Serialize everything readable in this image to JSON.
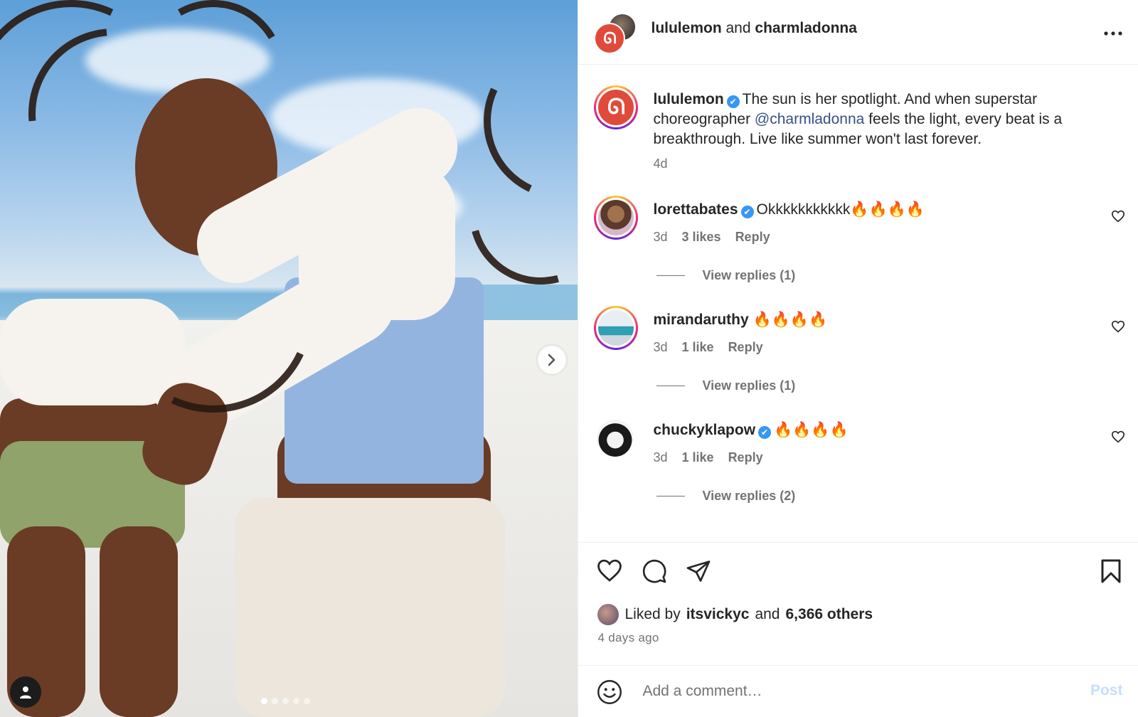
{
  "header": {
    "user1": "lululemon",
    "and": "and",
    "user2": "charmladonna"
  },
  "caption": {
    "username": "lululemon",
    "text_before": "The sun is her spotlight. And when superstar choreographer ",
    "mention": "@charmladonna",
    "text_after": " feels the light, every beat is a breakthrough. Live like summer won't last forever.",
    "time": "4d"
  },
  "comments": [
    {
      "username": "lorettabates",
      "verified": true,
      "text": "Okkkkkkkkkkk🔥🔥🔥🔥",
      "time": "3d",
      "likes": "3 likes",
      "reply": "Reply",
      "view_replies": "View replies (1)"
    },
    {
      "username": "mirandaruthy",
      "verified": false,
      "text": "🔥🔥🔥🔥",
      "time": "3d",
      "likes": "1 like",
      "reply": "Reply",
      "view_replies": "View replies (1)"
    },
    {
      "username": "chuckyklapow",
      "verified": true,
      "text": "🔥🔥🔥🔥",
      "time": "3d",
      "likes": "1 like",
      "reply": "Reply",
      "view_replies": "View replies (2)"
    }
  ],
  "likes": {
    "prefix": "Liked by",
    "user": "itsvickyc",
    "and": "and",
    "others": "6,366 others"
  },
  "posted_ago": "4 days ago",
  "comment_box": {
    "placeholder": "Add a comment…",
    "post_label": "Post"
  },
  "carousel": {
    "total": 5,
    "active": 0
  },
  "colors": {
    "accent": "#3897f0",
    "mention": "#385185",
    "post_disabled": "#c4dffc",
    "lululemon_red": "#e04a3a"
  }
}
